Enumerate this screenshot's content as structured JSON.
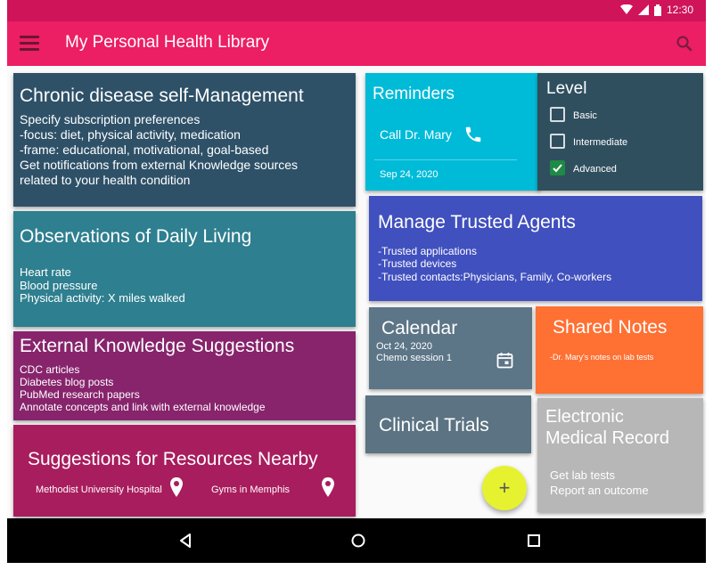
{
  "status_bar": {
    "time": "12:30",
    "wifi_icon": "wifi-icon",
    "signal_icon": "signal-icon",
    "battery_icon": "battery-icon"
  },
  "app_bar": {
    "menu_icon": "hamburger-menu-icon",
    "title": "My Personal Health Library",
    "search_icon": "search-icon"
  },
  "colors": {
    "status_bar": "#cf1459",
    "app_bar": "#ec1e64",
    "fab": "#e6f230"
  },
  "cards": {
    "chronic": {
      "title": "Chronic disease self-Management",
      "lines": [
        "Specify subscription preferences",
        "-focus: diet, physical activity, medication",
        "-frame: educational, motivational, goal-based",
        "Get notifications from external Knowledge sources",
        "related to your health condition"
      ]
    },
    "observations": {
      "title": "Observations of Daily Living",
      "lines": [
        "Heart rate",
        "Blood pressure",
        "Physical activity: X miles walked"
      ]
    },
    "external": {
      "title": "External Knowledge Suggestions",
      "lines": [
        "CDC articles",
        "Diabetes blog posts",
        "PubMed research papers",
        "Annotate concepts and link with external knowledge"
      ]
    },
    "resources": {
      "title": "Suggestions for Resources Nearby",
      "places": [
        {
          "label": "Methodist University Hospital",
          "icon": "location-pin-icon"
        },
        {
          "label": "Gyms in Memphis",
          "icon": "location-pin-icon"
        }
      ]
    },
    "reminders": {
      "title": "Reminders",
      "item": "Call Dr. Mary",
      "icon": "phone-icon",
      "date": "Sep 24, 2020"
    },
    "level": {
      "title": "Level",
      "options": [
        {
          "label": "Basic",
          "checked": false
        },
        {
          "label": "Intermediate",
          "checked": false
        },
        {
          "label": "Advanced",
          "checked": true
        }
      ]
    },
    "agents": {
      "title": "Manage Trusted Agents",
      "lines": [
        "-Trusted applications",
        "-Trusted devices",
        "-Trusted contacts:Physicians, Family, Co-workers"
      ]
    },
    "calendar": {
      "title": "Calendar",
      "date": "Oct 24, 2020",
      "event": "Chemo session 1",
      "icon": "calendar-icon"
    },
    "notes": {
      "title": "Shared Notes",
      "line": "-Dr. Mary's notes on lab tests"
    },
    "trials": {
      "title": "Clinical Trials"
    },
    "emr": {
      "title_line1": "Electronic",
      "title_line2": "Medical Record",
      "lines": [
        "Get lab tests",
        "Report an outcome"
      ]
    }
  },
  "fab": {
    "label": "+",
    "icon": "add-icon"
  },
  "nav_bar": {
    "back_icon": "back-icon",
    "home_icon": "home-icon",
    "recents_icon": "recents-icon"
  }
}
